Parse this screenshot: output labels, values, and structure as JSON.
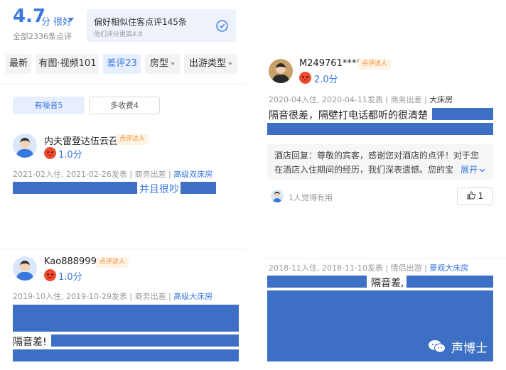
{
  "summary": {
    "score": "4.7",
    "unit": "分 很好",
    "total": "全部2336条点评",
    "similar_title": "偏好相似住客点评145条",
    "similar_sub": "他们评分更高4.8"
  },
  "tabs": [
    {
      "label": "最新"
    },
    {
      "label": "有图·视频101"
    },
    {
      "label": "差评23"
    },
    {
      "label": "房型"
    },
    {
      "label": "出游类型"
    }
  ],
  "subtabs": [
    {
      "label": "有噪音5"
    },
    {
      "label": "多收费4"
    }
  ],
  "reviews": [
    {
      "name": "内夫雷登达伍云召",
      "badge": "点评达人",
      "score": "1.0分",
      "date": "2021-02入住, 2021-02-26发表",
      "trip": "商务出差",
      "room": "高级双床房",
      "text": "并且很吵"
    },
    {
      "name": "Kao888999",
      "badge": "点评达人",
      "score": "1.0分",
      "date": "2019-10入住, 2019-10-29发表",
      "trip": "商务出差",
      "room": "高级大床房",
      "text": "隔音差!"
    },
    {
      "name": "M249761****",
      "badge": "点评达人",
      "score": "2.0分",
      "date": "2020-04入住, 2020-04-11发表",
      "trip": "商务出差",
      "room": "大床房",
      "text": "隔音很差，隔壁打电话都听的很清楚",
      "reply_line1": "酒店回复：尊敬的宾客，感谢您对酒店的点评！对于您",
      "reply_line2": "在酒店入住期间的经历，我们深表遗憾。您的宝",
      "expand": "展开",
      "helpful": "1人觉得有用",
      "likes": "1"
    },
    {
      "date": "2018-11入住, 2018-11-10发表",
      "trip": "情侣出游",
      "room": "景观大床房",
      "text": "隔音差,"
    }
  ],
  "watermark": "声博士",
  "icons": [
    "caret-down-icon",
    "check-circle-icon",
    "angry-face-icon",
    "thumbs-up-icon",
    "chevron-down-icon",
    "wechat-icon"
  ]
}
